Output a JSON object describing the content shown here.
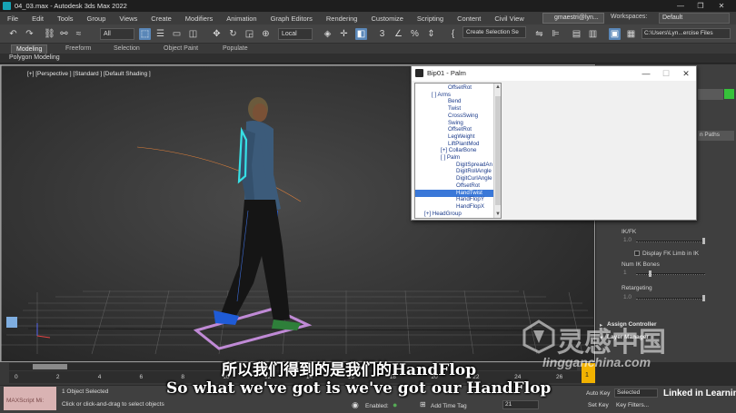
{
  "window": {
    "title": "04_03.max - Autodesk 3ds Max 2022",
    "controls": [
      "—",
      "❐",
      "✕"
    ]
  },
  "menu": [
    "File",
    "Edit",
    "Tools",
    "Group",
    "Views",
    "Create",
    "Modifiers",
    "Animation",
    "Graph Editors",
    "Rendering",
    "Customize",
    "Scripting",
    "Content",
    "Civil View"
  ],
  "user": "gmaestri@lyn...",
  "workspaces": {
    "label": "Workspaces:",
    "value": "Default"
  },
  "toolbar": {
    "filter": "All",
    "ref_coord": "Local",
    "selection_set": "Create Selection Se",
    "path": "C:\\Users\\Lyn...ercise Files"
  },
  "ribbon": {
    "tabs": [
      "Modeling",
      "Freeform",
      "Selection",
      "Object Paint",
      "Populate"
    ],
    "active_tab": "Modeling",
    "subtab": "Polygon Modeling"
  },
  "viewport": {
    "label": "[+] [Perspective ] [Standard ] [Default Shading ]"
  },
  "dialog": {
    "title": "Bip01 - Palm",
    "tree": [
      {
        "text": "OffsetRot",
        "indent": 36
      },
      {
        "text": "[ ] Arms",
        "indent": 18
      },
      {
        "text": "Bend",
        "indent": 36
      },
      {
        "text": "Twist",
        "indent": 36
      },
      {
        "text": "CrossSwing",
        "indent": 36
      },
      {
        "text": "Swing",
        "indent": 36
      },
      {
        "text": "OffsetRot",
        "indent": 36
      },
      {
        "text": "LegWeight",
        "indent": 36
      },
      {
        "text": "LiftPlantMod",
        "indent": 36
      },
      {
        "text": "[+] CollarBone",
        "indent": 28
      },
      {
        "text": "[ ] Palm",
        "indent": 28
      },
      {
        "text": "DigitSpreadAn",
        "indent": 45
      },
      {
        "text": "DigitRollAngle",
        "indent": 45
      },
      {
        "text": "DigitCurlAngle",
        "indent": 45
      },
      {
        "text": "OffsetRot",
        "indent": 45
      },
      {
        "text": "HandTwist",
        "indent": 45,
        "selected": true
      },
      {
        "text": "HandFlopY",
        "indent": 45
      },
      {
        "text": "HandFlopX",
        "indent": 45
      },
      {
        "text": "[+] HeadGroup",
        "indent": 10
      }
    ]
  },
  "command_panel": {
    "paths_button": "n Paths",
    "ikfk_label": "IK/FK",
    "ikfk_value": "1.0",
    "display_fk": "Display FK Limb in IK",
    "num_ik_label": "Num IK Bones",
    "num_ik_value": "1",
    "retargeting_label": "Retargeting",
    "retargeting_value": "1.0",
    "rollout_assign": "Assign Controller",
    "rollout_layer": "Layer Manager"
  },
  "timeline": {
    "ticks": [
      "0",
      "2",
      "4",
      "6",
      "8",
      "10",
      "12",
      "14",
      "16",
      "18",
      "20",
      "22",
      "24",
      "26"
    ],
    "end_label": "1"
  },
  "status": {
    "maxscript": "MAXScript Mi:",
    "line1": "1 Object Selected",
    "line2": "Click or click-and-drag to select objects",
    "enabled_label": "Enabled:",
    "add_time_tag": "Add Time Tag",
    "frame_value": "21",
    "auto_key": "Auto Key",
    "set_key": "Set Key",
    "selected": "Selected",
    "key_filters": "Key Filters..."
  },
  "subtitles": {
    "chinese": "所以我们得到的是我们的HandFlop",
    "english": "So what we've got is we've got our HandFlop"
  },
  "watermarks": {
    "brand_cn": "灵感中国",
    "brand_url": "lingganchina.com",
    "linkedin": "Linked in Learning"
  },
  "colors": {
    "selection_blue": "#3a78d8",
    "timeline_marker": "#f2b200",
    "bone_cyan": "#36e0e6",
    "footstep_purple": "#c08ad6"
  }
}
